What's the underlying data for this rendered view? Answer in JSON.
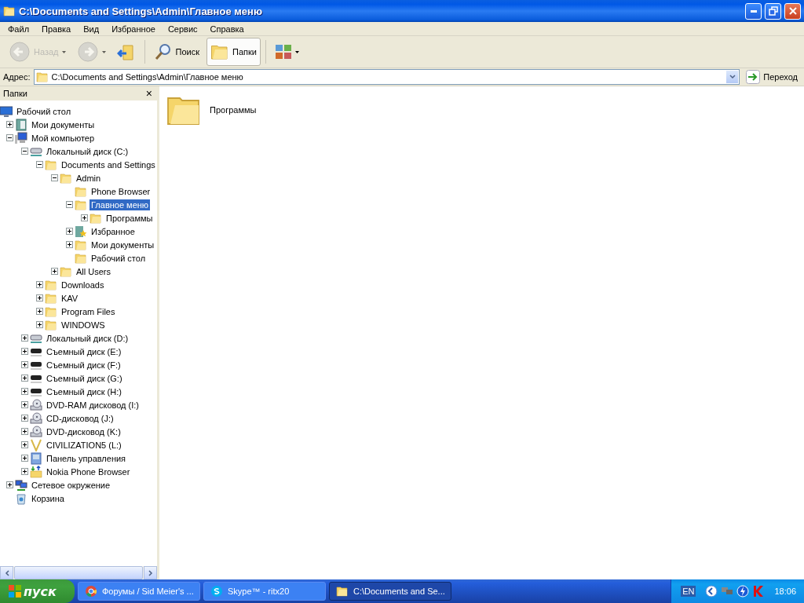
{
  "window": {
    "title": "C:\\Documents and Settings\\Admin\\Главное меню"
  },
  "menu": [
    "Файл",
    "Правка",
    "Вид",
    "Избранное",
    "Сервис",
    "Справка"
  ],
  "toolbar": [
    {
      "kind": "back",
      "label": "Назад",
      "disabled": true,
      "pressed": false
    },
    {
      "kind": "forward",
      "disabled": true,
      "pressed": false
    },
    {
      "kind": "up",
      "disabled": false,
      "pressed": false
    },
    {
      "kind": "search",
      "label": "Поиск",
      "disabled": false,
      "pressed": false
    },
    {
      "kind": "folders",
      "label": "Папки",
      "disabled": false,
      "pressed": true
    },
    {
      "kind": "views",
      "disabled": false,
      "pressed": false
    }
  ],
  "address": {
    "label": "Адрес:",
    "value": "C:\\Documents and Settings\\Admin\\Главное меню",
    "go": "Переход"
  },
  "folders_pane": {
    "title": "Папки",
    "close": "×"
  },
  "tree": [
    {
      "label": "Рабочий стол",
      "kind": "desktop",
      "selected": false,
      "children": [
        {
          "label": "Мои документы",
          "kind": "docs",
          "expanded": false,
          "selected": false
        },
        {
          "label": "Мой компьютер",
          "kind": "computer",
          "expanded": true,
          "selected": false,
          "children": [
            {
              "label": "Локальный диск (C:)",
              "kind": "drive",
              "expanded": true,
              "selected": false,
              "children": [
                {
                  "label": "Documents and Settings",
                  "kind": "folder",
                  "expanded": true,
                  "selected": false,
                  "children": [
                    {
                      "label": "Admin",
                      "kind": "folder",
                      "expanded": true,
                      "selected": false,
                      "children": [
                        {
                          "label": "Phone Browser",
                          "kind": "folder",
                          "selected": false
                        },
                        {
                          "label": "Главное меню",
                          "kind": "folder",
                          "expanded": true,
                          "selected": true,
                          "children": [
                            {
                              "label": "Программы",
                              "kind": "folder",
                              "expanded": false,
                              "selected": false
                            }
                          ]
                        },
                        {
                          "label": "Избранное",
                          "kind": "favorites",
                          "expanded": false,
                          "selected": false
                        },
                        {
                          "label": "Мои документы",
                          "kind": "folder",
                          "expanded": false,
                          "selected": false
                        },
                        {
                          "label": "Рабочий стол",
                          "kind": "folder",
                          "selected": false
                        }
                      ]
                    },
                    {
                      "label": "All Users",
                      "kind": "folder",
                      "expanded": false,
                      "selected": false
                    }
                  ]
                },
                {
                  "label": "Downloads",
                  "kind": "folder",
                  "expanded": false,
                  "selected": false
                },
                {
                  "label": "KAV",
                  "kind": "folder",
                  "expanded": false,
                  "selected": false
                },
                {
                  "label": "Program Files",
                  "kind": "folder",
                  "expanded": false,
                  "selected": false
                },
                {
                  "label": "WINDOWS",
                  "kind": "folder",
                  "expanded": false,
                  "selected": false
                }
              ]
            },
            {
              "label": "Локальный диск (D:)",
              "kind": "drive",
              "expanded": false,
              "selected": false
            },
            {
              "label": "Съемный диск (E:)",
              "kind": "removable",
              "expanded": false,
              "selected": false
            },
            {
              "label": "Съемный диск (F:)",
              "kind": "removable",
              "expanded": false,
              "selected": false
            },
            {
              "label": "Съемный диск (G:)",
              "kind": "removable",
              "expanded": false,
              "selected": false
            },
            {
              "label": "Съемный диск (H:)",
              "kind": "removable",
              "expanded": false,
              "selected": false
            },
            {
              "label": "DVD-RAM дисковод (I:)",
              "kind": "optical",
              "expanded": false,
              "selected": false
            },
            {
              "label": "CD-дисковод (J:)",
              "kind": "optical",
              "expanded": false,
              "selected": false
            },
            {
              "label": "DVD-дисковод (K:)",
              "kind": "optical",
              "expanded": false,
              "selected": false
            },
            {
              "label": "CIVILIZATION5 (L:)",
              "kind": "civ",
              "expanded": false,
              "selected": false
            },
            {
              "label": "Панель управления",
              "kind": "control",
              "expanded": false,
              "selected": false
            },
            {
              "label": "Nokia Phone Browser",
              "kind": "phone",
              "expanded": false,
              "selected": false
            }
          ]
        },
        {
          "label": "Сетевое окружение",
          "kind": "network",
          "expanded": false,
          "selected": false
        },
        {
          "label": "Корзина",
          "kind": "recycle",
          "selected": false
        }
      ]
    }
  ],
  "content": [
    {
      "label": "Программы"
    }
  ],
  "taskbar": {
    "start": "пуск",
    "tasks": [
      {
        "label": "Форумы / Sid Meier's ...",
        "kind": "chrome",
        "selected": false
      },
      {
        "label": "Skype™ - ritx20",
        "kind": "skype",
        "selected": false
      },
      {
        "label": "C:\\Documents and Se...",
        "kind": "folder",
        "selected": true
      }
    ],
    "language": "EN",
    "time": "18:06"
  }
}
